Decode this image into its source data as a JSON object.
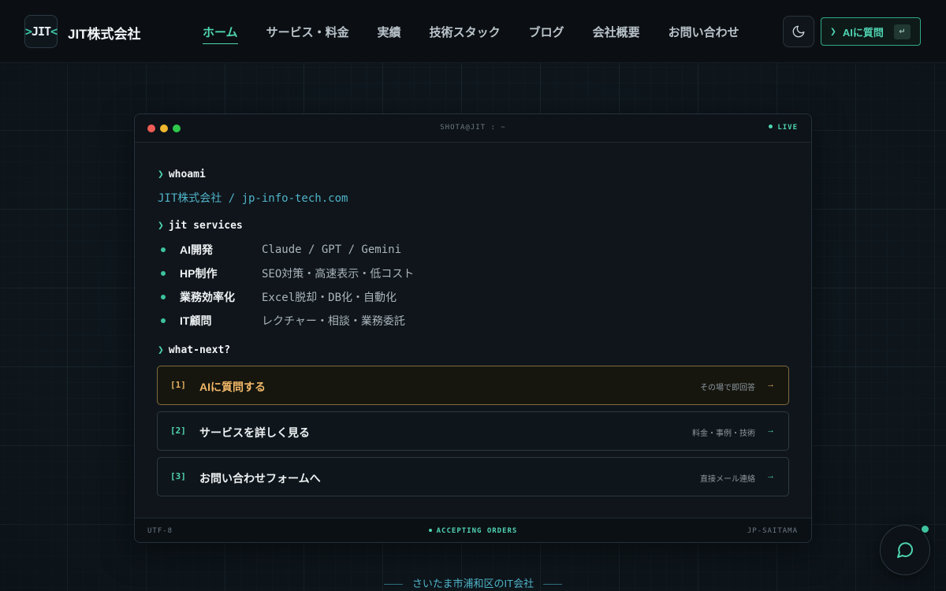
{
  "brand": {
    "logo_text": "JIT",
    "name": "JIT株式会社"
  },
  "nav": [
    {
      "label": "ホーム",
      "active": true
    },
    {
      "label": "サービス・料金"
    },
    {
      "label": "実績"
    },
    {
      "label": "技術スタック"
    },
    {
      "label": "ブログ"
    },
    {
      "label": "会社概要"
    },
    {
      "label": "お問い合わせ"
    }
  ],
  "header_actions": {
    "theme_icon": "moon-icon",
    "ai_button": {
      "chevron": "❯",
      "label": "AIに質問",
      "key_hint": "↵"
    }
  },
  "terminal": {
    "title": "SHOTA@JIT : ~",
    "status": "LIVE",
    "prompt_char": "❯",
    "cmd_whoami": "whoami",
    "whoami_output": "JIT株式会社 / jp-info-tech.com",
    "cmd_services": "jit services",
    "services": [
      {
        "name": "AI開発",
        "desc": "Claude / GPT / Gemini"
      },
      {
        "name": "HP制作",
        "desc": "SEO対策・高速表示・低コスト"
      },
      {
        "name": "業務効率化",
        "desc": "Excel脱却・DB化・自動化"
      },
      {
        "name": "IT顧問",
        "desc": "レクチャー・相談・業務委託"
      }
    ],
    "cmd_next": "what-next?",
    "options": [
      {
        "num": "[1]",
        "label": "AIに質問する",
        "hint": "その場で即回答",
        "arrow": "→"
      },
      {
        "num": "[2]",
        "label": "サービスを詳しく見る",
        "hint": "料金・事例・技術",
        "arrow": "→"
      },
      {
        "num": "[3]",
        "label": "お問い合わせフォームへ",
        "hint": "直接メール連絡",
        "arrow": "→"
      }
    ],
    "footer": {
      "left": "UTF-8",
      "center": "ACCEPTING ORDERS",
      "right": "JP-SAITAMA"
    }
  },
  "tagline": "さいたま市浦和区のIT会社",
  "chat_icon": "chat-bubble-icon",
  "colors": {
    "accent": "#4fd3b1",
    "highlight": "#f0b767",
    "background": "#0d141a"
  }
}
